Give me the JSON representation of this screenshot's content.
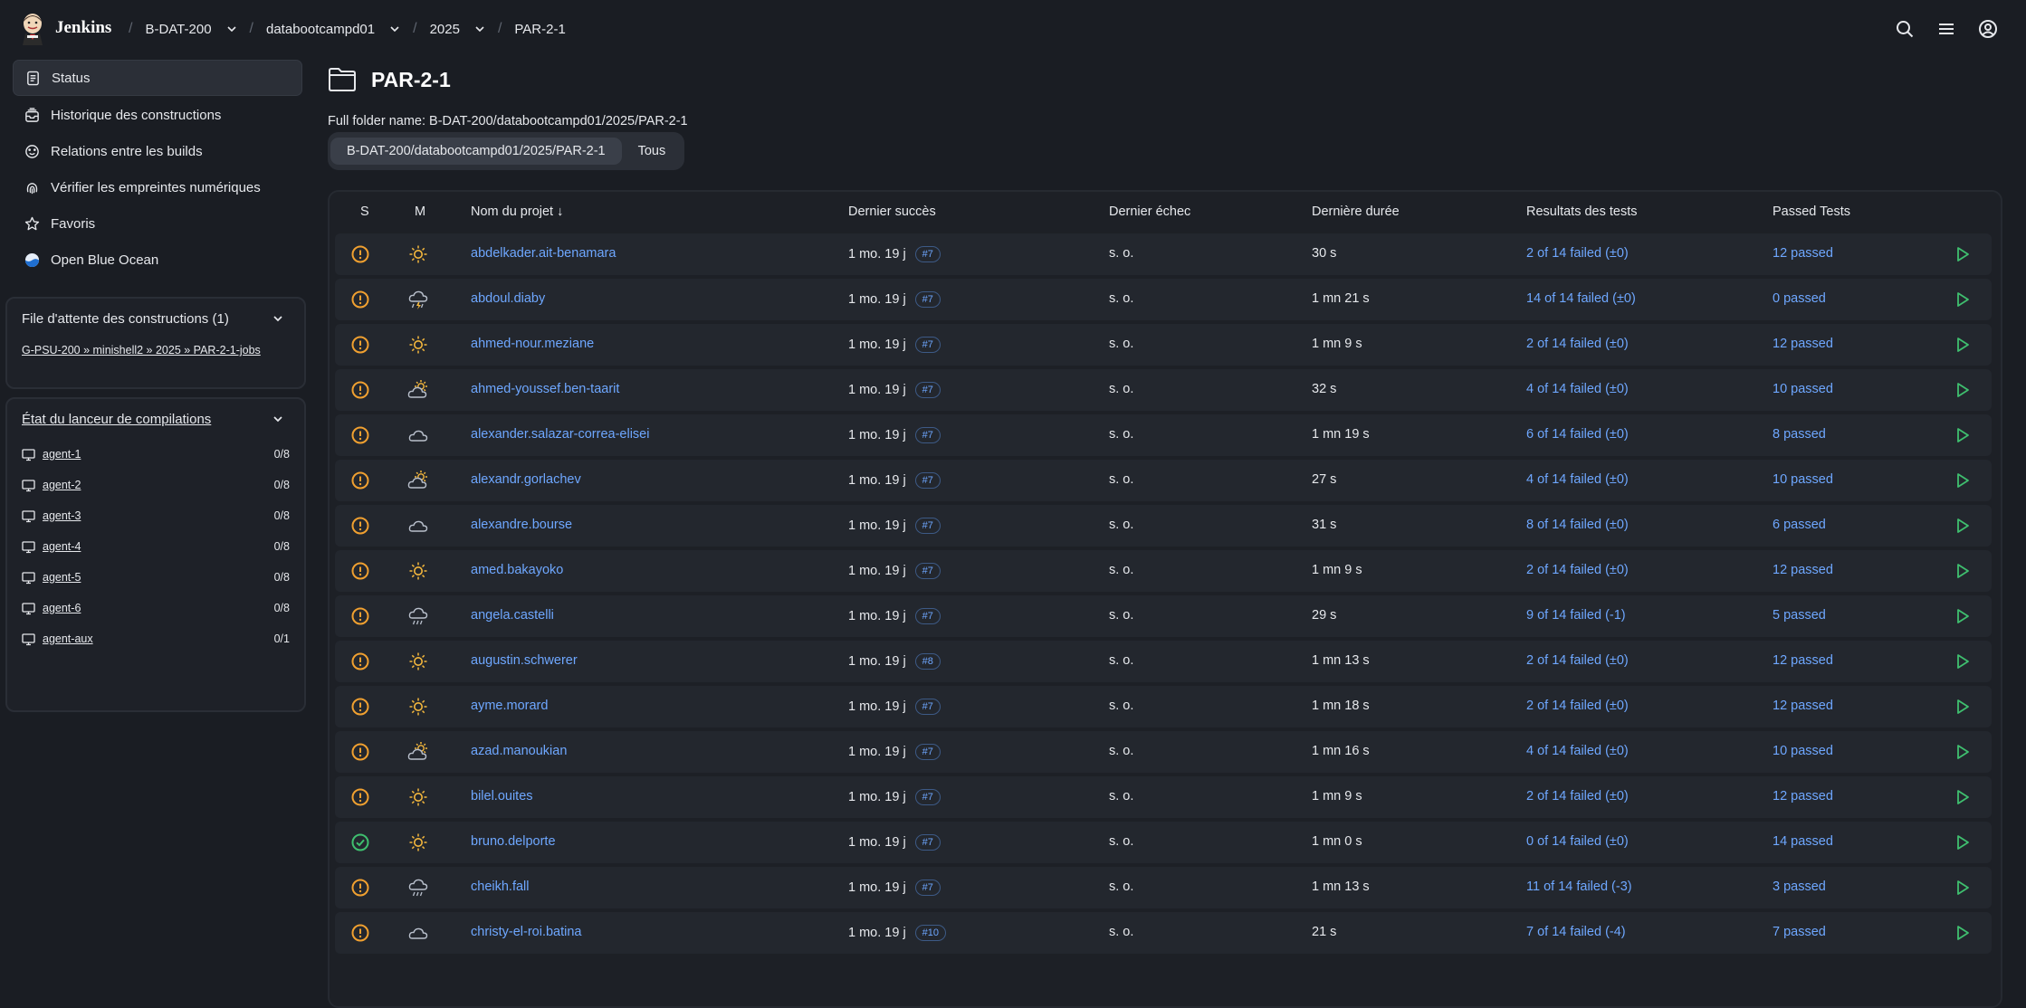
{
  "header": {
    "brand": "Jenkins",
    "breadcrumbs": [
      {
        "label": "B-DAT-200",
        "dropdown": true
      },
      {
        "label": "databootcampd01",
        "dropdown": true
      },
      {
        "label": "2025",
        "dropdown": true
      },
      {
        "label": "PAR-2-1",
        "dropdown": false
      }
    ],
    "icons": [
      "search-icon",
      "menu-icon",
      "user-icon"
    ]
  },
  "sidebar": {
    "items": [
      {
        "label": "Status",
        "icon": "status-icon",
        "active": true
      },
      {
        "label": "Historique des constructions",
        "icon": "history-icon",
        "active": false
      },
      {
        "label": "Relations entre les builds",
        "icon": "relations-icon",
        "active": false
      },
      {
        "label": "Vérifier les empreintes numériques",
        "icon": "fingerprint-icon",
        "active": false
      },
      {
        "label": "Favoris",
        "icon": "star-icon",
        "active": false
      },
      {
        "label": "Open Blue Ocean",
        "icon": "blue-ocean-icon",
        "active": false
      }
    ],
    "queue": {
      "title": "File d'attente des constructions (1)",
      "item": "G-PSU-200 » minishell2 » 2025 » PAR-2-1-jobs"
    },
    "executors": {
      "title": "État du lanceur de compilations",
      "agents": [
        {
          "name": "agent-1",
          "count": "0/8"
        },
        {
          "name": "agent-2",
          "count": "0/8"
        },
        {
          "name": "agent-3",
          "count": "0/8"
        },
        {
          "name": "agent-4",
          "count": "0/8"
        },
        {
          "name": "agent-5",
          "count": "0/8"
        },
        {
          "name": "agent-6",
          "count": "0/8"
        },
        {
          "name": "agent-aux",
          "count": "0/1"
        }
      ]
    }
  },
  "main": {
    "title": "PAR-2-1",
    "full_name": "Full folder name: B-DAT-200/databootcampd01/2025/PAR-2-1",
    "tabs": [
      {
        "label": "B-DAT-200/databootcampd01/2025/PAR-2-1",
        "selected": true
      },
      {
        "label": "Tous",
        "selected": false
      }
    ],
    "columns": {
      "s": "S",
      "m": "M",
      "name": "Nom du projet ↓",
      "last_success": "Dernier succès",
      "last_failure": "Dernier échec",
      "last_duration": "Dernière durée",
      "test_results": "Resultats des tests",
      "passed_tests": "Passed Tests"
    },
    "rows": [
      {
        "status": "warning",
        "weather": "sunny",
        "name": "abdelkader.ait-benamara",
        "success": "1 mo. 19 j",
        "build": "#7",
        "failure": "s. o.",
        "duration": "30 s",
        "tests": "2 of 14 failed (±0)",
        "passed": "12 passed"
      },
      {
        "status": "warning",
        "weather": "storm",
        "name": "abdoul.diaby",
        "success": "1 mo. 19 j",
        "build": "#7",
        "failure": "s. o.",
        "duration": "1 mn 21 s",
        "tests": "14 of 14 failed (±0)",
        "passed": "0 passed"
      },
      {
        "status": "warning",
        "weather": "sunny",
        "name": "ahmed-nour.meziane",
        "success": "1 mo. 19 j",
        "build": "#7",
        "failure": "s. o.",
        "duration": "1 mn 9 s",
        "tests": "2 of 14 failed (±0)",
        "passed": "12 passed"
      },
      {
        "status": "warning",
        "weather": "partly-cloudy",
        "name": "ahmed-youssef.ben-taarit",
        "success": "1 mo. 19 j",
        "build": "#7",
        "failure": "s. o.",
        "duration": "32 s",
        "tests": "4 of 14 failed (±0)",
        "passed": "10 passed"
      },
      {
        "status": "warning",
        "weather": "cloudy",
        "name": "alexander.salazar-correa-elisei",
        "success": "1 mo. 19 j",
        "build": "#7",
        "failure": "s. o.",
        "duration": "1 mn 19 s",
        "tests": "6 of 14 failed (±0)",
        "passed": "8 passed"
      },
      {
        "status": "warning",
        "weather": "partly-cloudy",
        "name": "alexandr.gorlachev",
        "success": "1 mo. 19 j",
        "build": "#7",
        "failure": "s. o.",
        "duration": "27 s",
        "tests": "4 of 14 failed (±0)",
        "passed": "10 passed"
      },
      {
        "status": "warning",
        "weather": "cloudy",
        "name": "alexandre.bourse",
        "success": "1 mo. 19 j",
        "build": "#7",
        "failure": "s. o.",
        "duration": "31 s",
        "tests": "8 of 14 failed (±0)",
        "passed": "6 passed"
      },
      {
        "status": "warning",
        "weather": "sunny",
        "name": "amed.bakayoko",
        "success": "1 mo. 19 j",
        "build": "#7",
        "failure": "s. o.",
        "duration": "1 mn 9 s",
        "tests": "2 of 14 failed (±0)",
        "passed": "12 passed"
      },
      {
        "status": "warning",
        "weather": "rain",
        "name": "angela.castelli",
        "success": "1 mo. 19 j",
        "build": "#7",
        "failure": "s. o.",
        "duration": "29 s",
        "tests": "9 of 14 failed (-1)",
        "passed": "5 passed"
      },
      {
        "status": "warning",
        "weather": "sunny",
        "name": "augustin.schwerer",
        "success": "1 mo. 19 j",
        "build": "#8",
        "failure": "s. o.",
        "duration": "1 mn 13 s",
        "tests": "2 of 14 failed (±0)",
        "passed": "12 passed"
      },
      {
        "status": "warning",
        "weather": "sunny",
        "name": "ayme.morard",
        "success": "1 mo. 19 j",
        "build": "#7",
        "failure": "s. o.",
        "duration": "1 mn 18 s",
        "tests": "2 of 14 failed (±0)",
        "passed": "12 passed"
      },
      {
        "status": "warning",
        "weather": "partly-cloudy",
        "name": "azad.manoukian",
        "success": "1 mo. 19 j",
        "build": "#7",
        "failure": "s. o.",
        "duration": "1 mn 16 s",
        "tests": "4 of 14 failed (±0)",
        "passed": "10 passed"
      },
      {
        "status": "warning",
        "weather": "sunny",
        "name": "bilel.ouites",
        "success": "1 mo. 19 j",
        "build": "#7",
        "failure": "s. o.",
        "duration": "1 mn 9 s",
        "tests": "2 of 14 failed (±0)",
        "passed": "12 passed"
      },
      {
        "status": "success",
        "weather": "sunny",
        "name": "bruno.delporte",
        "success": "1 mo. 19 j",
        "build": "#7",
        "failure": "s. o.",
        "duration": "1 mn 0 s",
        "tests": "0 of 14 failed (±0)",
        "passed": "14 passed"
      },
      {
        "status": "warning",
        "weather": "rain",
        "name": "cheikh.fall",
        "success": "1 mo. 19 j",
        "build": "#7",
        "failure": "s. o.",
        "duration": "1 mn 13 s",
        "tests": "11 of 14 failed (-3)",
        "passed": "3 passed"
      },
      {
        "status": "warning",
        "weather": "cloudy",
        "name": "christy-el-roi.batina",
        "success": "1 mo. 19 j",
        "build": "#10",
        "failure": "s. o.",
        "duration": "21 s",
        "tests": "7 of 14 failed (-4)",
        "passed": "7 passed"
      }
    ]
  },
  "colors": {
    "background": "#1a1d23",
    "link": "#6ea7ff",
    "warning": "#f0a030",
    "success": "#3fbf6f",
    "sun": "#f5b83d",
    "cloud": "#b9c0cc"
  }
}
